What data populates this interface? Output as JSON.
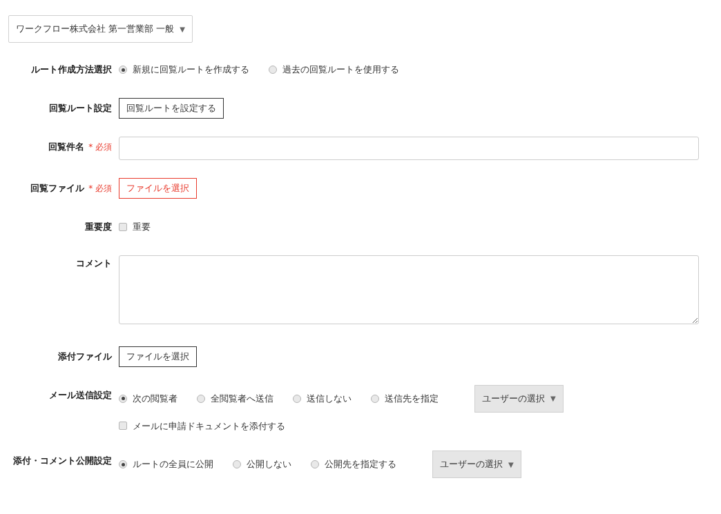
{
  "org_select": {
    "value": "ワークフロー株式会社 第一営業部 一般",
    "caret": "▼"
  },
  "rows": [
    {
      "kind": "radio",
      "label": "ルート作成方法選択",
      "options": [
        {
          "label": "新規に回覧ルートを作成する",
          "selected": true
        },
        {
          "label": "過去の回覧ルートを使用する",
          "selected": false
        }
      ]
    },
    {
      "kind": "button",
      "label": "回覧ルート設定",
      "button": "回覧ルートを設定する"
    },
    {
      "kind": "text",
      "label": "回覧件名",
      "required": "* 必須"
    },
    {
      "kind": "file",
      "label": "回覧ファイル",
      "required": "* 必須",
      "button": "ファイルを選択"
    },
    {
      "kind": "checkbox",
      "label": "重要度",
      "options": [
        {
          "label": "重要",
          "checked": false
        }
      ]
    },
    {
      "kind": "textarea",
      "label": "コメント"
    },
    {
      "kind": "button",
      "label": "添付ファイル",
      "button": "ファイルを選択"
    },
    {
      "kind": "radio",
      "label": "メール送信設定",
      "options": [
        {
          "label": "次の閲覧者",
          "selected": true
        },
        {
          "label": "全閲覧者へ送信",
          "selected": false
        },
        {
          "label": "送信しない",
          "selected": false
        },
        {
          "label": "送信先を指定",
          "selected": false
        }
      ],
      "user_select": {
        "value": "ユーザーの選択",
        "caret": "▼"
      },
      "extra_checkbox": {
        "label": "メールに申請ドキュメントを添付する",
        "checked": false
      }
    },
    {
      "kind": "radio",
      "label": "添付・コメント公開設定",
      "options": [
        {
          "label": "ルートの全員に公開",
          "selected": true
        },
        {
          "label": "公開しない",
          "selected": false
        },
        {
          "label": "公開先を指定する",
          "selected": false
        }
      ],
      "user_select": {
        "value": "ユーザーの選択",
        "caret": "▼"
      }
    }
  ]
}
